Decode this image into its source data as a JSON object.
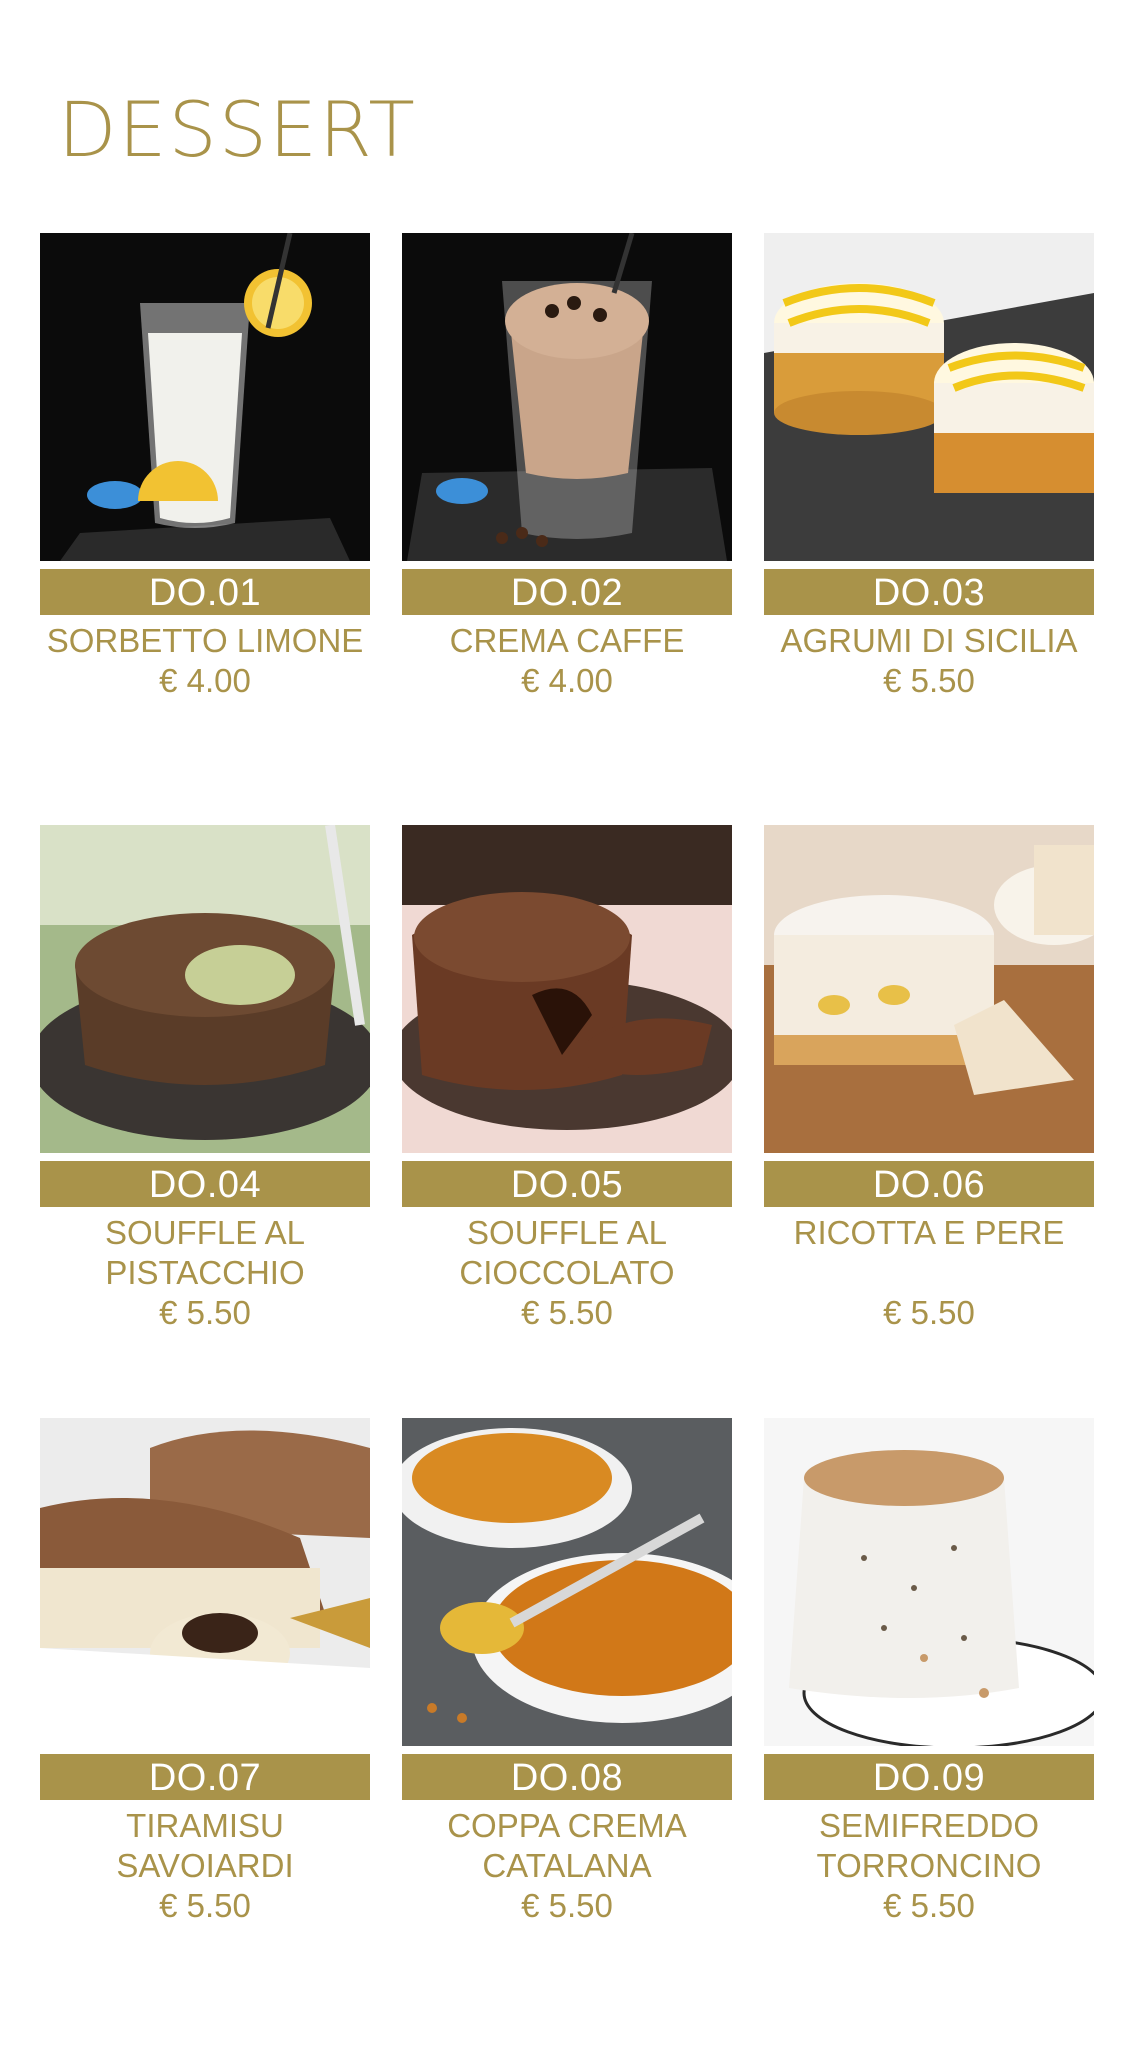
{
  "page": {
    "title": "DESSERT",
    "accent_color": "#a9934a"
  },
  "items": [
    {
      "code": "DO.01",
      "name_line1": "SORBETTO LIMONE",
      "name_line2": "",
      "price": "€ 4.00"
    },
    {
      "code": "DO.02",
      "name_line1": "CREMA CAFFE",
      "name_line2": "",
      "price": "€ 4.00"
    },
    {
      "code": "DO.03",
      "name_line1": "AGRUMI DI SICILIA",
      "name_line2": "",
      "price": "€ 5.50"
    },
    {
      "code": "DO.04",
      "name_line1": "SOUFFLE AL",
      "name_line2": "PISTACCHIO",
      "price": "€ 5.50"
    },
    {
      "code": "DO.05",
      "name_line1": "SOUFFLE AL",
      "name_line2": "CIOCCOLATO",
      "price": "€ 5.50"
    },
    {
      "code": "DO.06",
      "name_line1": "RICOTTA E PERE",
      "name_line2": "",
      "price": "€ 5.50"
    },
    {
      "code": "DO.07",
      "name_line1": "TIRAMISU",
      "name_line2": "SAVOIARDI",
      "price": "€ 5.50"
    },
    {
      "code": "DO.08",
      "name_line1": "COPPA CREMA",
      "name_line2": "CATALANA",
      "price": "€ 5.50"
    },
    {
      "code": "DO.09",
      "name_line1": "SEMIFREDDO",
      "name_line2": "TORRONCINO",
      "price": "€ 5.50"
    }
  ]
}
